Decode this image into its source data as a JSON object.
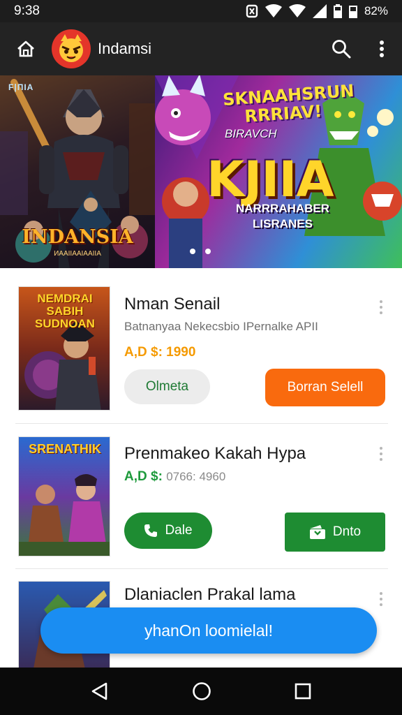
{
  "status_bar": {
    "time": "9:38",
    "battery": "82%",
    "icons": [
      "nfc-icon",
      "wifi-icon",
      "wifi-icon",
      "cell-signal-icon",
      "battery-icon"
    ]
  },
  "app_bar": {
    "title": "Indamsi",
    "icons": [
      "home-icon",
      "app-logo",
      "search-icon",
      "more-vert-icon"
    ]
  },
  "banner": {
    "left": {
      "tag": "F|ПIA",
      "title": "INDANSIA",
      "subtitle": "ИAAIIAAIAAIIA"
    },
    "right": {
      "top_text": "SKNAAHSRUN RRRIAV!",
      "small_text": "BIRAVCH",
      "big_text": "KJIIA",
      "sub_text": "NARRRAHABER LISRANES"
    },
    "pagination_dots": 2
  },
  "items": [
    {
      "thumb_title": "NEMDRAI SABIH SUDNOAN",
      "title": "Nman Senail",
      "subtitle": "Batnanyaa Nekecsbio IPernalke APII",
      "price": "A,D $: 1990",
      "price_color": "#f59a00",
      "buttons": [
        {
          "label": "Olmeta",
          "style": "outline",
          "icon": ""
        },
        {
          "label": "Borran Selell",
          "style": "primary-orange",
          "icon": ""
        }
      ]
    },
    {
      "thumb_title": "SRENATHIK",
      "title": "Prenmakeo Kakah Hypa",
      "subtitle": "",
      "price": "A,D $:",
      "price_extra": "0766: 4960",
      "price_color": "#1e9a3c",
      "buttons": [
        {
          "label": "Dale",
          "style": "green",
          "icon": "phone-icon"
        },
        {
          "label": "Dnto",
          "style": "green",
          "icon": "ticket-icon"
        }
      ]
    },
    {
      "thumb_title": "",
      "title": "Dlaniaclen Prakal lama",
      "subtitle": "",
      "price": "",
      "buttons": []
    }
  ],
  "fab": {
    "label": "yhanOn loomielal!"
  },
  "colors": {
    "status_bar": "#1d1d1d",
    "app_bar": "#232323",
    "accent_orange": "#f96a0e",
    "accent_green": "#1e8c32",
    "accent_blue": "#1a8df2",
    "nav_bar": "#0a0a0a"
  },
  "nav_bar": {
    "icons": [
      "back-icon",
      "home-icon",
      "recents-icon"
    ]
  }
}
